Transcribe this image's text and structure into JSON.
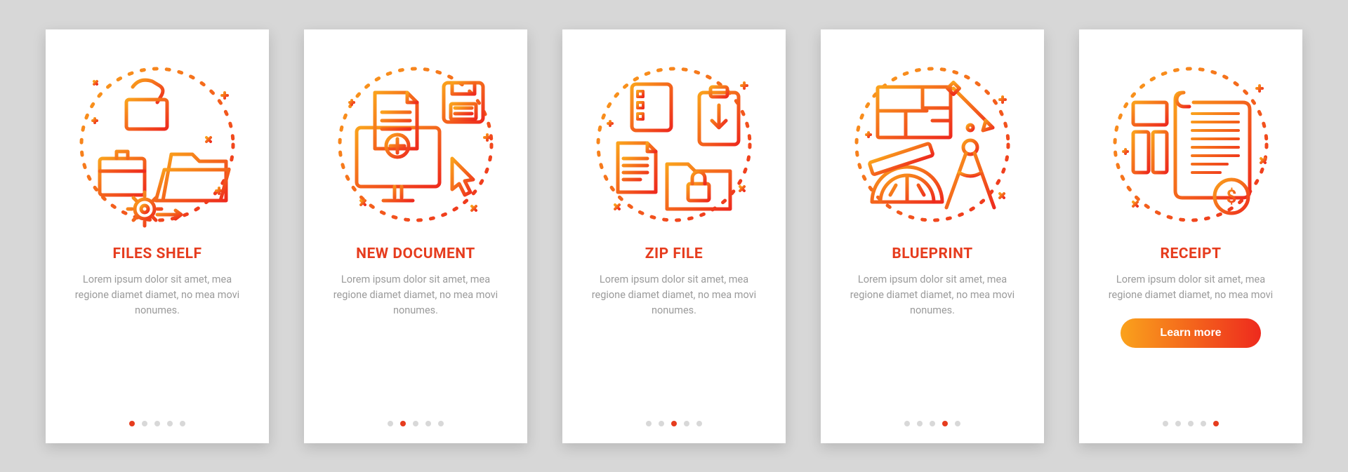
{
  "colors": {
    "accent": "#e63c1e",
    "gradientStart": "#faa21c",
    "gradientEnd": "#ee2a1d",
    "muted": "#9b9b9b"
  },
  "cards": [
    {
      "title": "Files shelf",
      "desc": "Lorem ipsum dolor sit amet, mea regione diamet diamet, no mea movi nonumes.",
      "activeDot": 0,
      "icon": "files-shelf-icon",
      "cta": null
    },
    {
      "title": "New document",
      "desc": "Lorem ipsum dolor sit amet, mea regione diamet diamet, no mea movi nonumes.",
      "activeDot": 1,
      "icon": "new-document-icon",
      "cta": null
    },
    {
      "title": "Zip file",
      "desc": "Lorem ipsum dolor sit amet, mea regione diamet diamet, no mea movi nonumes.",
      "activeDot": 2,
      "icon": "zip-file-icon",
      "cta": null
    },
    {
      "title": "Blueprint",
      "desc": "Lorem ipsum dolor sit amet, mea regione diamet diamet, no mea movi nonumes.",
      "activeDot": 3,
      "icon": "blueprint-icon",
      "cta": null
    },
    {
      "title": "Receipt",
      "desc": "Lorem ipsum dolor sit amet, mea regione diamet diamet, no mea movi",
      "activeDot": 4,
      "icon": "receipt-icon",
      "cta": "Learn more"
    }
  ]
}
